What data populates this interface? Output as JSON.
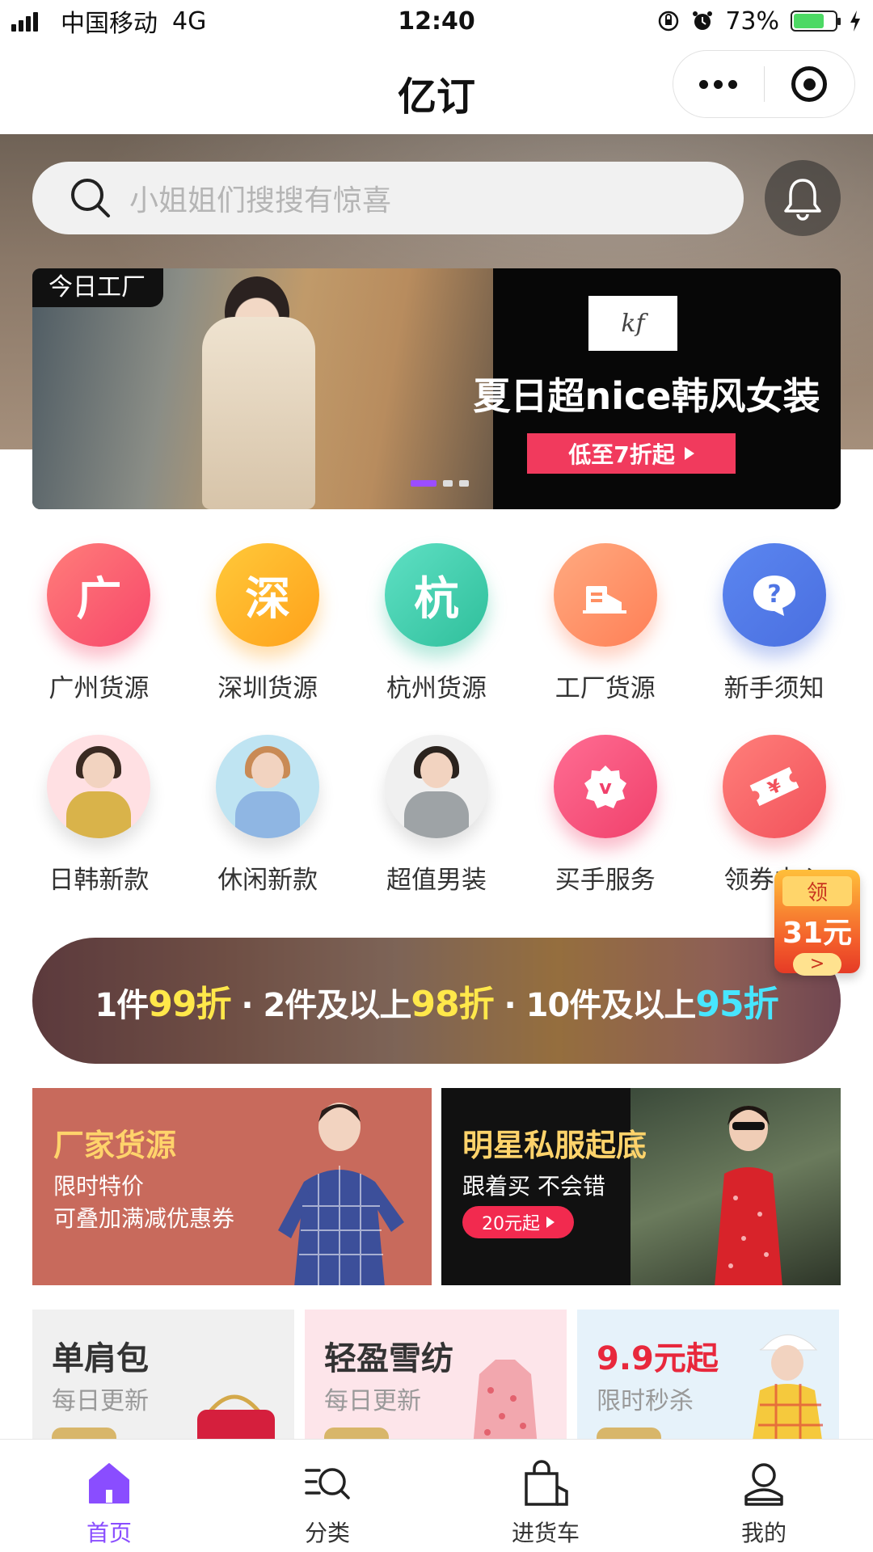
{
  "status_bar": {
    "carrier": "中国移动",
    "network": "4G",
    "time": "12:40",
    "battery": "73%",
    "battery_level": 0.73
  },
  "nav": {
    "title": "亿订"
  },
  "search": {
    "placeholder": "小姐姐们搜搜有惊喜"
  },
  "banner": {
    "badge": "今日工厂",
    "logo_text": "kf",
    "headline": "夏日超nice韩风女装",
    "cta": "低至7折起",
    "page_count": 3,
    "active_page": 0
  },
  "categories": [
    {
      "label": "广州货源",
      "icon_text": "广",
      "icon": "guangzhou-icon"
    },
    {
      "label": "深圳货源",
      "icon_text": "深",
      "icon": "shenzhen-icon"
    },
    {
      "label": "杭州货源",
      "icon_text": "杭",
      "icon": "hangzhou-icon"
    },
    {
      "label": "工厂货源",
      "icon_text": "",
      "icon": "factory-icon"
    },
    {
      "label": "新手须知",
      "icon_text": "?",
      "icon": "help-icon"
    },
    {
      "label": "日韩新款",
      "icon_text": "",
      "icon": "model-photo"
    },
    {
      "label": "休闲新款",
      "icon_text": "",
      "icon": "model-photo"
    },
    {
      "label": "超值男装",
      "icon_text": "",
      "icon": "model-photo"
    },
    {
      "label": "买手服务",
      "icon_text": "v",
      "icon": "buyer-service-icon"
    },
    {
      "label": "领券中心",
      "icon_text": "¥",
      "icon": "ticket-icon"
    }
  ],
  "coupon": {
    "top": "领",
    "amount": "31元",
    "arrow": ">"
  },
  "discount": {
    "t1": "1件",
    "v1": "99",
    "u1": "折",
    "sep": " · ",
    "t2": "2件及以上",
    "v2": "98",
    "u2": "折",
    "t3": "10件及以上",
    "v3": "95",
    "u3": "折"
  },
  "promos": [
    {
      "title": "厂家货源",
      "line1": "限时特价",
      "line2": "可叠加满减优惠券"
    },
    {
      "title": "明星私服起底",
      "line1": "跟着买 不会错",
      "button": "20元起"
    }
  ],
  "mini_cards": [
    {
      "title": "单肩包",
      "subtitle": "每日更新"
    },
    {
      "title": "轻盈雪纺",
      "subtitle": "每日更新"
    },
    {
      "title": "9.9元起",
      "subtitle": "限时秒杀"
    }
  ],
  "tabs": [
    {
      "label": "首页",
      "icon": "home-icon",
      "active": true
    },
    {
      "label": "分类",
      "icon": "category-search-icon",
      "active": false
    },
    {
      "label": "进货车",
      "icon": "shopping-bag-icon",
      "active": false
    },
    {
      "label": "我的",
      "icon": "user-icon",
      "active": false
    }
  ],
  "colors": {
    "accent": "#8a4dff",
    "cta_red": "#f13a5d",
    "highlight_yellow": "#ffe84a",
    "highlight_cyan": "#47e6ff"
  }
}
